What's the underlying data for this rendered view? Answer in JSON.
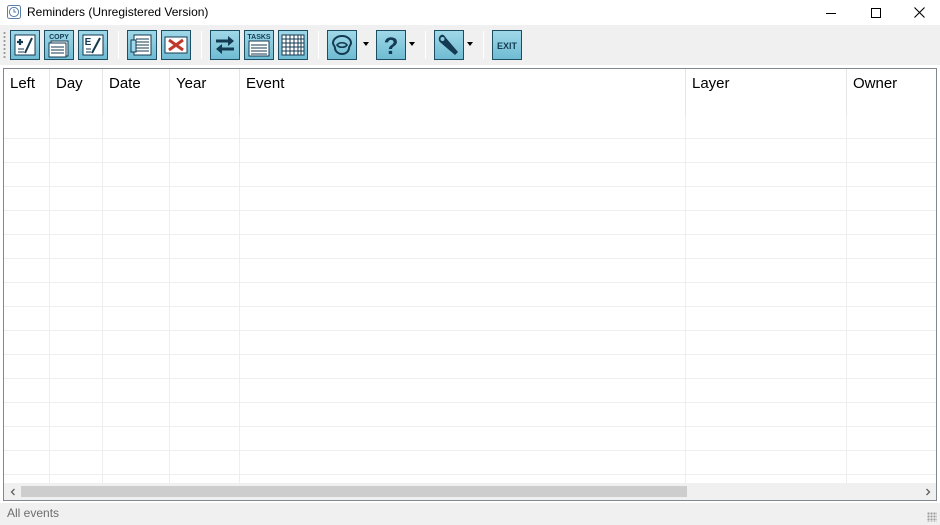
{
  "window": {
    "title": "Reminders (Unregistered Version)"
  },
  "toolbar": {
    "buttons": [
      {
        "name": "new-reminder",
        "icon": "add-note-icon"
      },
      {
        "name": "copy-reminder",
        "icon": "copy-icon",
        "label": "COPY"
      },
      {
        "name": "edit-reminder",
        "icon": "edit-note-icon"
      },
      {
        "name": "print",
        "icon": "print-list-icon"
      },
      {
        "name": "delete",
        "icon": "delete-x-icon"
      },
      {
        "name": "toggle-view",
        "icon": "swap-arrows-icon"
      },
      {
        "name": "tasks",
        "icon": "tasks-icon",
        "label": "TASKS"
      },
      {
        "name": "calendar",
        "icon": "calendar-grid-icon"
      },
      {
        "name": "layers",
        "icon": "layers-icon"
      },
      {
        "name": "help",
        "icon": "help-question-icon"
      },
      {
        "name": "options",
        "icon": "wrench-icon"
      },
      {
        "name": "exit",
        "icon": "exit-icon",
        "label": "EXIT"
      }
    ]
  },
  "grid": {
    "columns": [
      "Left",
      "Day",
      "Date",
      "Year",
      "Event",
      "Layer",
      "Owner"
    ],
    "rows": []
  },
  "statusbar": {
    "text": "All events"
  },
  "colors": {
    "toolbar_button_fill": "#8ccde0",
    "toolbar_button_border": "#1c4d63",
    "icon_dark": "#143a52"
  }
}
